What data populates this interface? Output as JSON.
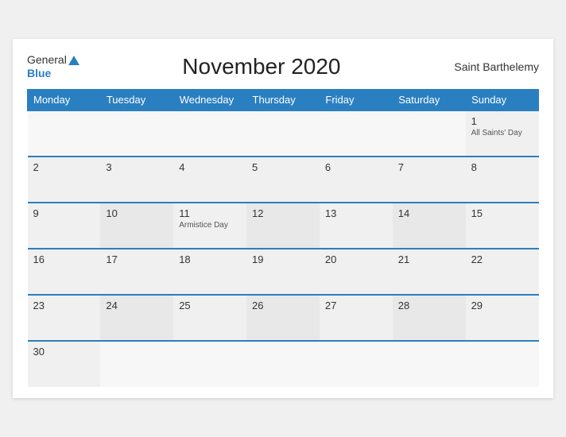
{
  "header": {
    "logo_general": "General",
    "logo_blue": "Blue",
    "title": "November 2020",
    "region": "Saint Barthelemy"
  },
  "days": {
    "headers": [
      "Monday",
      "Tuesday",
      "Wednesday",
      "Thursday",
      "Friday",
      "Saturday",
      "Sunday"
    ]
  },
  "weeks": [
    [
      {
        "num": "",
        "holiday": ""
      },
      {
        "num": "",
        "holiday": ""
      },
      {
        "num": "",
        "holiday": ""
      },
      {
        "num": "",
        "holiday": ""
      },
      {
        "num": "",
        "holiday": ""
      },
      {
        "num": "",
        "holiday": ""
      },
      {
        "num": "1",
        "holiday": "All Saints' Day"
      }
    ],
    [
      {
        "num": "2",
        "holiday": ""
      },
      {
        "num": "3",
        "holiday": ""
      },
      {
        "num": "4",
        "holiday": ""
      },
      {
        "num": "5",
        "holiday": ""
      },
      {
        "num": "6",
        "holiday": ""
      },
      {
        "num": "7",
        "holiday": ""
      },
      {
        "num": "8",
        "holiday": ""
      }
    ],
    [
      {
        "num": "9",
        "holiday": ""
      },
      {
        "num": "10",
        "holiday": ""
      },
      {
        "num": "11",
        "holiday": "Armistice Day"
      },
      {
        "num": "12",
        "holiday": ""
      },
      {
        "num": "13",
        "holiday": ""
      },
      {
        "num": "14",
        "holiday": ""
      },
      {
        "num": "15",
        "holiday": ""
      }
    ],
    [
      {
        "num": "16",
        "holiday": ""
      },
      {
        "num": "17",
        "holiday": ""
      },
      {
        "num": "18",
        "holiday": ""
      },
      {
        "num": "19",
        "holiday": ""
      },
      {
        "num": "20",
        "holiday": ""
      },
      {
        "num": "21",
        "holiday": ""
      },
      {
        "num": "22",
        "holiday": ""
      }
    ],
    [
      {
        "num": "23",
        "holiday": ""
      },
      {
        "num": "24",
        "holiday": ""
      },
      {
        "num": "25",
        "holiday": ""
      },
      {
        "num": "26",
        "holiday": ""
      },
      {
        "num": "27",
        "holiday": ""
      },
      {
        "num": "28",
        "holiday": ""
      },
      {
        "num": "29",
        "holiday": ""
      }
    ],
    [
      {
        "num": "30",
        "holiday": ""
      },
      {
        "num": "",
        "holiday": ""
      },
      {
        "num": "",
        "holiday": ""
      },
      {
        "num": "",
        "holiday": ""
      },
      {
        "num": "",
        "holiday": ""
      },
      {
        "num": "",
        "holiday": ""
      },
      {
        "num": "",
        "holiday": ""
      }
    ]
  ]
}
